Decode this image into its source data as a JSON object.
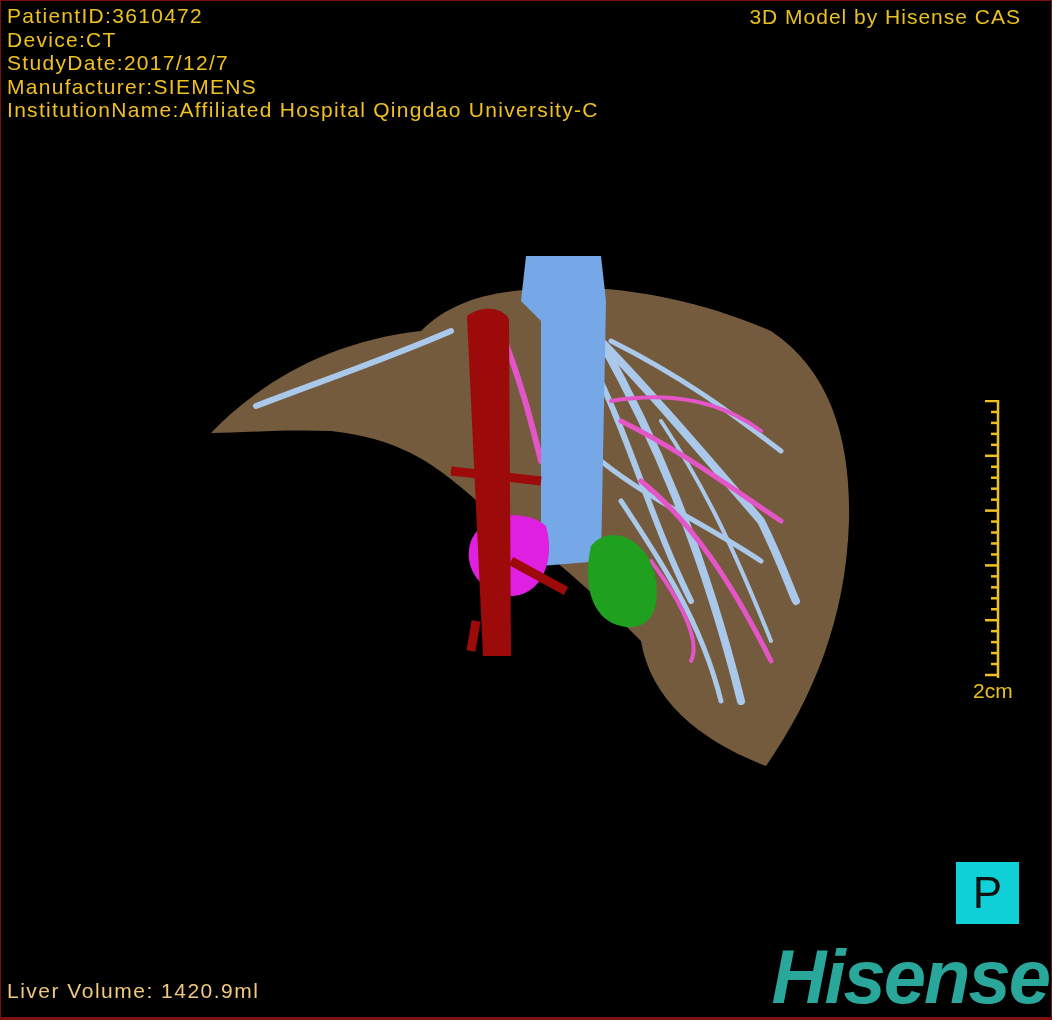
{
  "patient_info": [
    "PatientID:3610472",
    "Device:CT",
    "StudyDate:2017/12/7",
    "Manufacturer:SIEMENS",
    "InstitutionName:Affiliated Hospital Qingdao University-C"
  ],
  "credit": "3D Model by Hisense CAS",
  "scale_bar": {
    "label": "2cm"
  },
  "orientation_marker": "P",
  "liver_volume": "Liver Volume: 1420.9ml",
  "logo": "Hisense"
}
